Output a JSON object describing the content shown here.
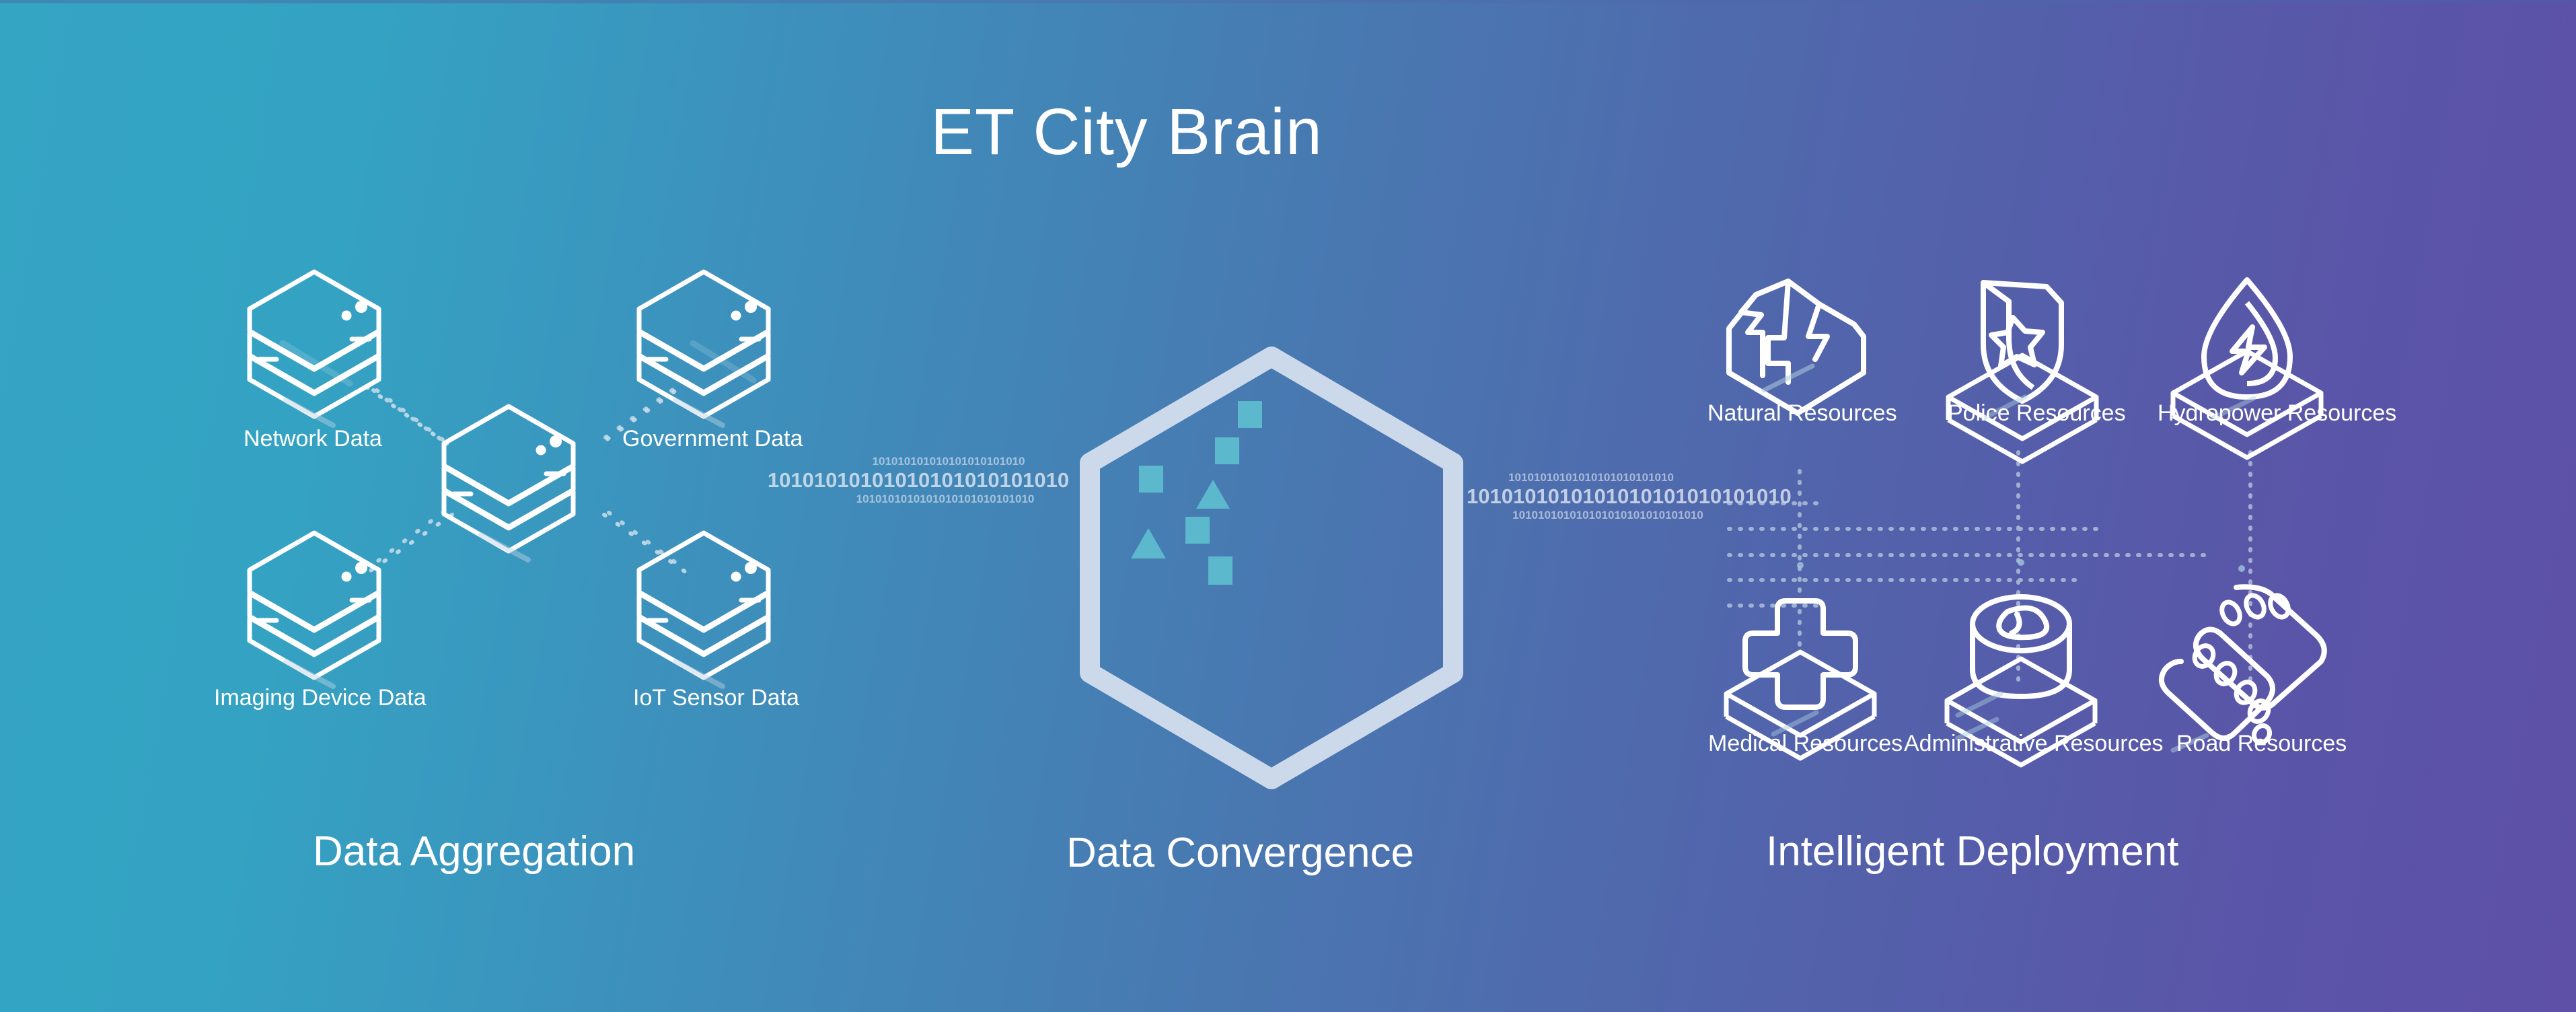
{
  "page": {
    "title": "ET City Brain",
    "background": {
      "from": "#35a5c4",
      "mid": "#4a76b0",
      "to": "#5d50a6"
    },
    "accents": {
      "line_white": "#ffffff",
      "hexagon_outline": "#ccd9ea",
      "shape_fill": "#5bb8cd",
      "binary_text": "#dfe7f2",
      "dotted_link": "#b9cbe0"
    }
  },
  "sections": [
    {
      "id": "aggregation",
      "caption": "Data Aggregation"
    },
    {
      "id": "convergence",
      "caption": "Data Convergence"
    },
    {
      "id": "deployment",
      "caption": "Intelligent Deployment"
    }
  ],
  "aggregation": {
    "caption": "Data Aggregation",
    "center_node": {
      "icon": "server-stack-icon"
    },
    "nodes": [
      {
        "id": "network",
        "label": "Network Data",
        "icon": "server-stack-icon",
        "position": "top-left"
      },
      {
        "id": "government",
        "label": "Government Data",
        "icon": "server-stack-icon",
        "position": "top-right"
      },
      {
        "id": "imaging",
        "label": "Imaging Device Data",
        "icon": "server-stack-icon",
        "position": "bottom-left"
      },
      {
        "id": "iot",
        "label": "IoT Sensor Data",
        "icon": "server-stack-icon",
        "position": "bottom-right"
      }
    ]
  },
  "connectors": {
    "left": {
      "icon": "binary-stream-icon",
      "rows": [
        "101010101010101010101010",
        "10101010101010101010101010",
        "1010101010101010101010101010"
      ]
    },
    "right": {
      "icon": "binary-stream-icon",
      "rows": [
        "10101010101010101010101010",
        "1010101010101010101010101010",
        "101010101010101010101010101010"
      ]
    }
  },
  "convergence": {
    "caption": "Data Convergence",
    "hexagon": {
      "icon": "hexagon-outline-icon",
      "outline_color": "#ccd9ea"
    },
    "shapes": [
      {
        "type": "square",
        "fill": "#5bb8cd"
      },
      {
        "type": "square",
        "fill": "#5bb8cd"
      },
      {
        "type": "square",
        "fill": "#5bb8cd"
      },
      {
        "type": "triangle",
        "fill": "#5bb8cd"
      },
      {
        "type": "square",
        "fill": "#5bb8cd"
      },
      {
        "type": "triangle",
        "fill": "#5bb8cd"
      },
      {
        "type": "square",
        "fill": "#5bb8cd"
      }
    ]
  },
  "deployment": {
    "caption": "Intelligent Deployment",
    "rows": [
      [
        {
          "id": "natural",
          "label": "Natural Resources",
          "icon": "mountain-hexagon-icon"
        },
        {
          "id": "police",
          "label": "Police Resources",
          "icon": "shield-star-icon"
        },
        {
          "id": "hydropower",
          "label": "Hydropower Resources",
          "icon": "water-drop-bolt-icon"
        }
      ],
      [
        {
          "id": "medical",
          "label": "Medical Resources",
          "icon": "medical-cross-icon"
        },
        {
          "id": "administrative",
          "label": "Administrative Resources",
          "icon": "official-seal-icon"
        },
        {
          "id": "road",
          "label": "Road Resources",
          "icon": "winding-road-icon"
        }
      ]
    ],
    "link_grid": {
      "icon": "dotted-grid-icon",
      "color": "#b9cbe0"
    }
  }
}
